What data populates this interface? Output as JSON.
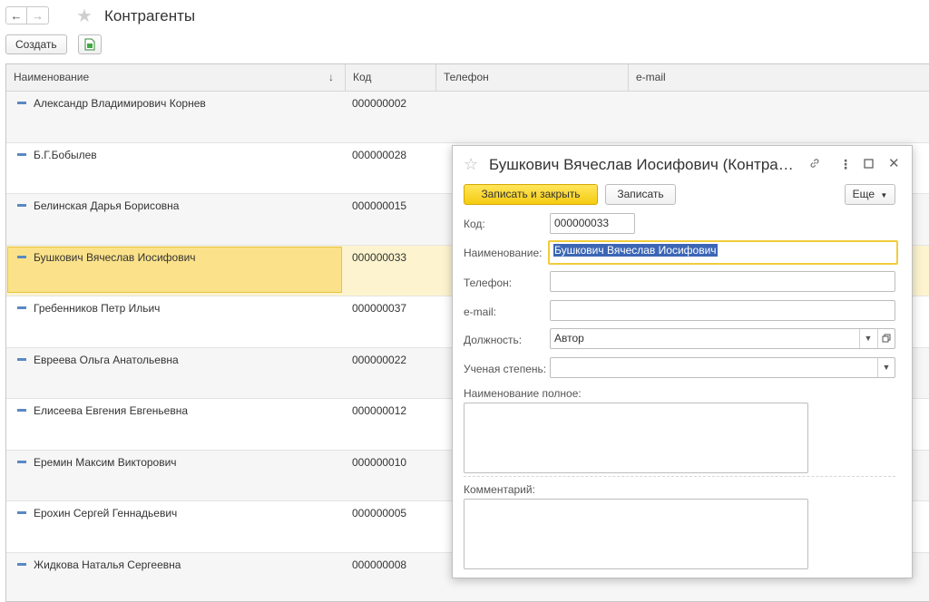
{
  "header": {
    "back_label": "←",
    "forward_label": "→",
    "title": "Контрагенты",
    "create_label": "Создать"
  },
  "table": {
    "columns": [
      "Наименование",
      "Код",
      "Телефон",
      "e-mail"
    ],
    "sort_indicator": "↓",
    "rows": [
      {
        "name": "Александр Владимирович Корнев",
        "code": "000000002"
      },
      {
        "name": "Б.Г.Бобылев",
        "code": "000000028"
      },
      {
        "name": "Белинская Дарья Борисовна",
        "code": "000000015"
      },
      {
        "name": "Бушкович Вячеслав Иосифович",
        "code": "000000033",
        "selected": true
      },
      {
        "name": "Гребенников Петр Ильич",
        "code": "000000037"
      },
      {
        "name": "Евреева Ольга Анатольевна",
        "code": "000000022"
      },
      {
        "name": "Елисеева Евгения Евгеньевна",
        "code": "000000012"
      },
      {
        "name": "Еремин Максим Викторович",
        "code": "000000010"
      },
      {
        "name": "Ерохин Сергей Геннадьевич",
        "code": "000000005"
      },
      {
        "name": "Жидкова Наталья Сергеевна",
        "code": "000000008"
      }
    ]
  },
  "dialog": {
    "title": "Бушкович Вячеслав Иосифович (Контрагент)",
    "save_close_label": "Записать и закрыть",
    "save_label": "Записать",
    "more_label": "Еще",
    "fields": {
      "code_label": "Код:",
      "code_value": "000000033",
      "name_label": "Наименование:",
      "name_value": "Бушкович Вячеслав Иосифович",
      "phone_label": "Телефон:",
      "phone_value": "",
      "email_label": "e-mail:",
      "email_value": "",
      "position_label": "Должность:",
      "position_value": "Автор",
      "degree_label": "Ученая степень:",
      "degree_value": "",
      "fullname_label": "Наименование полное:",
      "comment_label": "Комментарий:"
    }
  }
}
